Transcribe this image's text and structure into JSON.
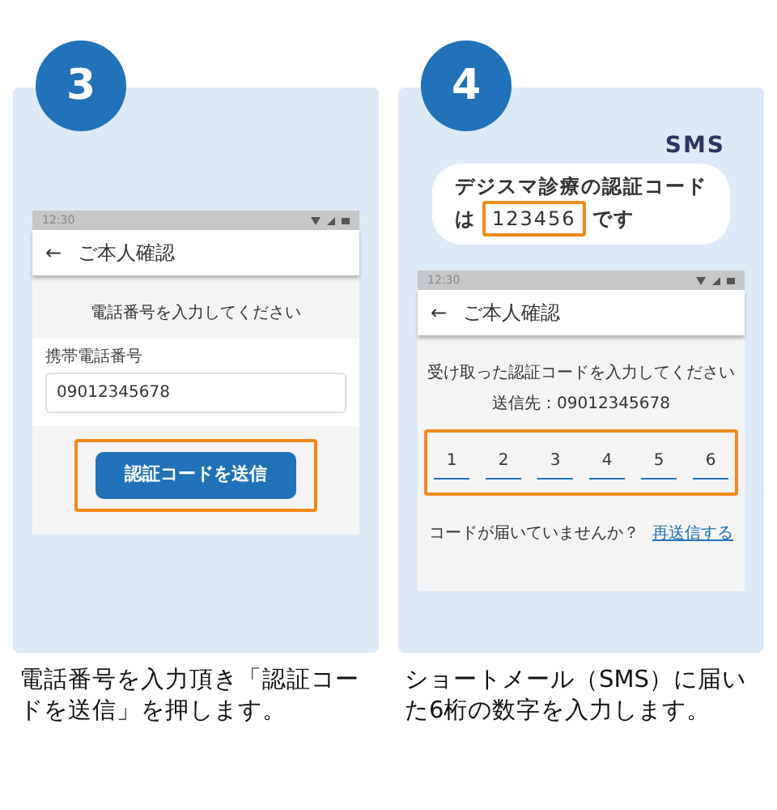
{
  "steps": [
    {
      "number": "3",
      "kind": "phone-entry",
      "phone": {
        "status_time": "12:30",
        "back": "←",
        "title": "ご本人確認",
        "prompt": "電話番号を入力してください",
        "field_label": "携帯電話番号",
        "field_value": "09012345678",
        "button": "認証コードを送信"
      },
      "caption": "電話番号を入力頂き「認証コードを送信」を押します。"
    },
    {
      "number": "4",
      "kind": "code-entry",
      "sms": {
        "label": "SMS",
        "line_1": "デジスマ診療の認証コード",
        "before_code": "は",
        "code": "123456",
        "after_code": "です"
      },
      "phone": {
        "status_time": "12:30",
        "back": "←",
        "title": "ご本人確認",
        "prompt": "受け取った認証コードを入力してください",
        "sent_to": "送信先：09012345678",
        "digits": [
          "1",
          "2",
          "3",
          "4",
          "5",
          "6"
        ],
        "resend_question": "コードが届いていませんか？",
        "resend_link": "再送信する"
      },
      "caption": "ショートメール（SMS）に届いた6桁の数字を入力します。"
    }
  ]
}
